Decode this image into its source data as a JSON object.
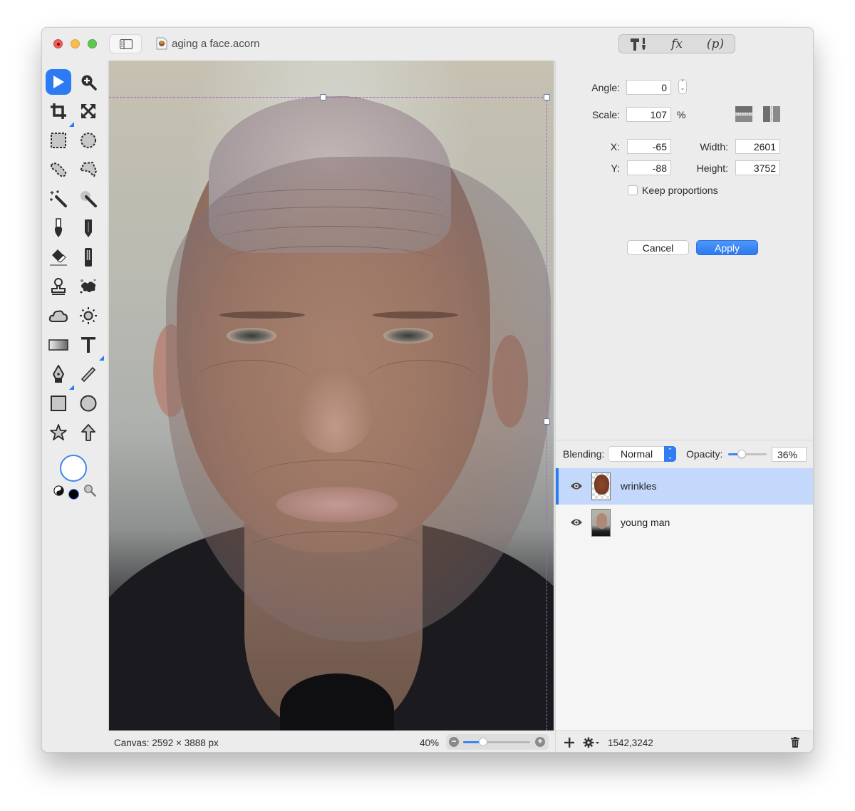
{
  "window": {
    "title": "aging a face.acorn",
    "segments": [
      {
        "name": "tools-segment",
        "label": ""
      },
      {
        "name": "filters-segment",
        "label": "fx"
      },
      {
        "name": "properties-segment",
        "label": "(p)"
      }
    ]
  },
  "tools": [
    {
      "name": "select-tool",
      "icon": "arrow-pointer-icon",
      "active": true
    },
    {
      "name": "zoom-tool",
      "icon": "zoom-in-icon"
    },
    {
      "name": "crop-tool",
      "icon": "crop-icon"
    },
    {
      "name": "transform-tool",
      "icon": "expand-arrows-icon"
    },
    {
      "name": "rect-select-tool",
      "icon": "rect-marquee-icon"
    },
    {
      "name": "ellipse-select-tool",
      "icon": "ellipse-marquee-icon"
    },
    {
      "name": "lasso-tool",
      "icon": "lasso-icon"
    },
    {
      "name": "polygon-lasso-tool",
      "icon": "polygon-lasso-icon"
    },
    {
      "name": "magic-wand-tool",
      "icon": "magic-wand-icon"
    },
    {
      "name": "instant-alpha-tool",
      "icon": "instant-alpha-icon"
    },
    {
      "name": "brush-tool",
      "icon": "brush-icon"
    },
    {
      "name": "pencil-tool",
      "icon": "pencil-icon"
    },
    {
      "name": "eraser-tool",
      "icon": "eraser-icon"
    },
    {
      "name": "smudge-tool",
      "icon": "smudge-icon"
    },
    {
      "name": "clone-stamp-tool",
      "icon": "stamp-icon"
    },
    {
      "name": "burn-tool",
      "icon": "splatter-icon"
    },
    {
      "name": "shape-cloud-tool",
      "icon": "cloud-icon"
    },
    {
      "name": "dodge-tool",
      "icon": "sun-icon"
    },
    {
      "name": "gradient-tool",
      "icon": "gradient-icon"
    },
    {
      "name": "text-tool",
      "icon": "text-icon"
    },
    {
      "name": "pen-tool",
      "icon": "pen-nib-icon"
    },
    {
      "name": "line-tool",
      "icon": "line-icon"
    },
    {
      "name": "rectangle-tool",
      "icon": "square-icon"
    },
    {
      "name": "oval-tool",
      "icon": "circle-icon"
    },
    {
      "name": "star-tool",
      "icon": "star-icon"
    },
    {
      "name": "arrow-tool",
      "icon": "arrow-up-icon"
    }
  ],
  "colors": {
    "fill": "#ffffff",
    "stroke": "#000000",
    "accent": "#2c7bf2",
    "selection": "#a066c0"
  },
  "inspector": {
    "angle_label": "Angle:",
    "angle_value": "0",
    "scale_label": "Scale:",
    "scale_value": "107",
    "scale_unit": "%",
    "x_label": "X:",
    "x_value": "-65",
    "y_label": "Y:",
    "y_value": "-88",
    "width_label": "Width:",
    "width_value": "2601",
    "height_label": "Height:",
    "height_value": "3752",
    "keep_proportions_label": "Keep proportions",
    "keep_proportions_checked": false,
    "cancel_label": "Cancel",
    "apply_label": "Apply"
  },
  "layers_panel": {
    "blending_label": "Blending:",
    "blending_value": "Normal",
    "opacity_label": "Opacity:",
    "opacity_value": "36%",
    "opacity_fraction": 0.36,
    "layers": [
      {
        "name": "wrinkles",
        "visible": true,
        "selected": true
      },
      {
        "name": "young man",
        "visible": true,
        "selected": false
      }
    ]
  },
  "status": {
    "canvas_size": "Canvas: 2592 × 3888 px",
    "zoom_level": "40%",
    "zoom_fraction": 0.3,
    "cursor_coords": "1542,3242"
  }
}
